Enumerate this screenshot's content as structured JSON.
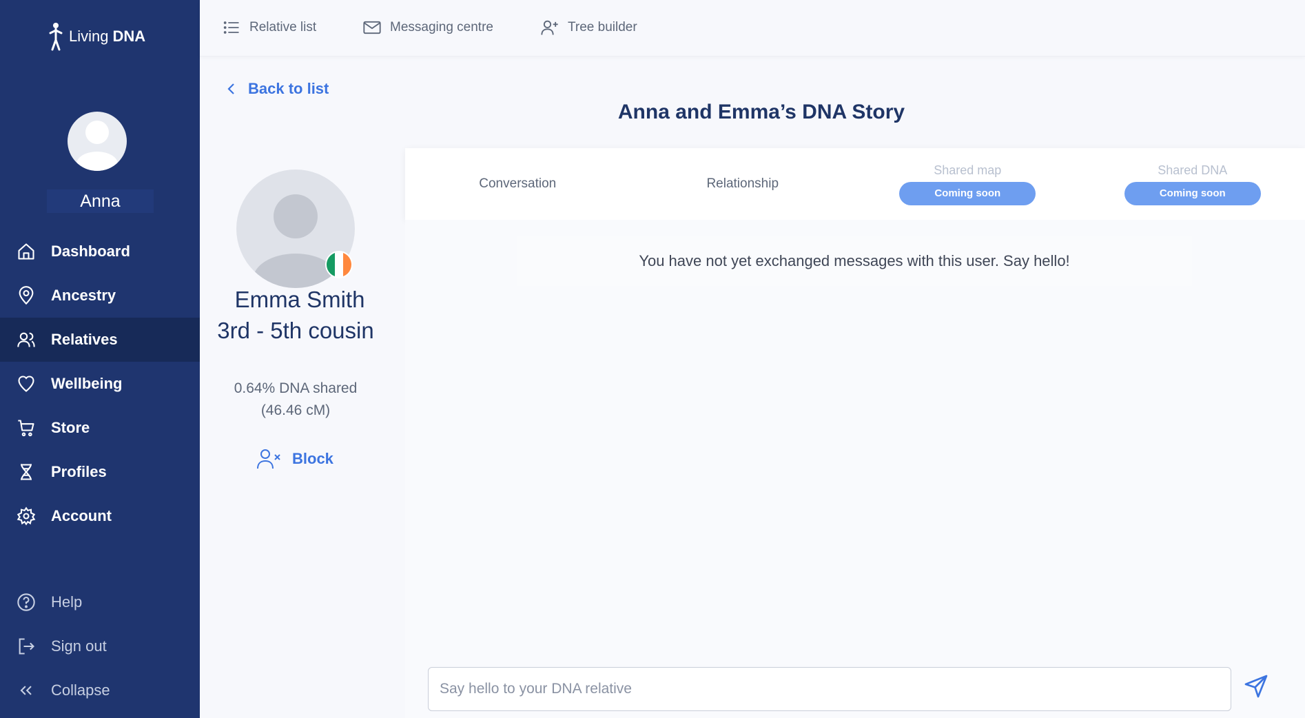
{
  "brand": {
    "living": "Living",
    "dna": "DNA"
  },
  "user": {
    "name": "Anna"
  },
  "sidebar": {
    "items": [
      {
        "label": "Dashboard",
        "icon": "home-icon"
      },
      {
        "label": "Ancestry",
        "icon": "map-pin-icon"
      },
      {
        "label": "Relatives",
        "icon": "users-icon",
        "active": true
      },
      {
        "label": "Wellbeing",
        "icon": "heart-icon"
      },
      {
        "label": "Store",
        "icon": "cart-icon"
      },
      {
        "label": "Profiles",
        "icon": "dna-icon"
      },
      {
        "label": "Account",
        "icon": "gear-icon"
      }
    ],
    "bottom": [
      {
        "label": "Help",
        "icon": "help-icon"
      },
      {
        "label": "Sign out",
        "icon": "sign-out-icon"
      },
      {
        "label": "Collapse",
        "icon": "chevrons-left-icon"
      }
    ]
  },
  "topnav": {
    "relative_list": "Relative list",
    "messaging_centre": "Messaging centre",
    "tree_builder": "Tree builder"
  },
  "back_label": "Back to list",
  "page_title": "Anna and Emma’s DNA Story",
  "relative": {
    "name": "Emma Smith",
    "relationship": "3rd - 5th cousin",
    "dna_shared": "0.64% DNA shared",
    "cm": "(46.46 cM)",
    "block_label": "Block",
    "flag_colors": [
      "#169b62",
      "#ffffff",
      "#ff883e"
    ]
  },
  "tabs": [
    {
      "label": "Conversation"
    },
    {
      "label": "Relationship"
    },
    {
      "label": "Shared map",
      "badge": "Coming soon"
    },
    {
      "label": "Shared DNA",
      "badge": "Coming soon"
    }
  ],
  "conversation": {
    "empty_message": "You have not yet exchanged messages with this user. Say hello!",
    "input_placeholder": "Say hello to your DNA relative"
  },
  "colors": {
    "sidebar": "#1f356f",
    "accent": "#3c74e0",
    "badge": "#6e9ef0"
  }
}
